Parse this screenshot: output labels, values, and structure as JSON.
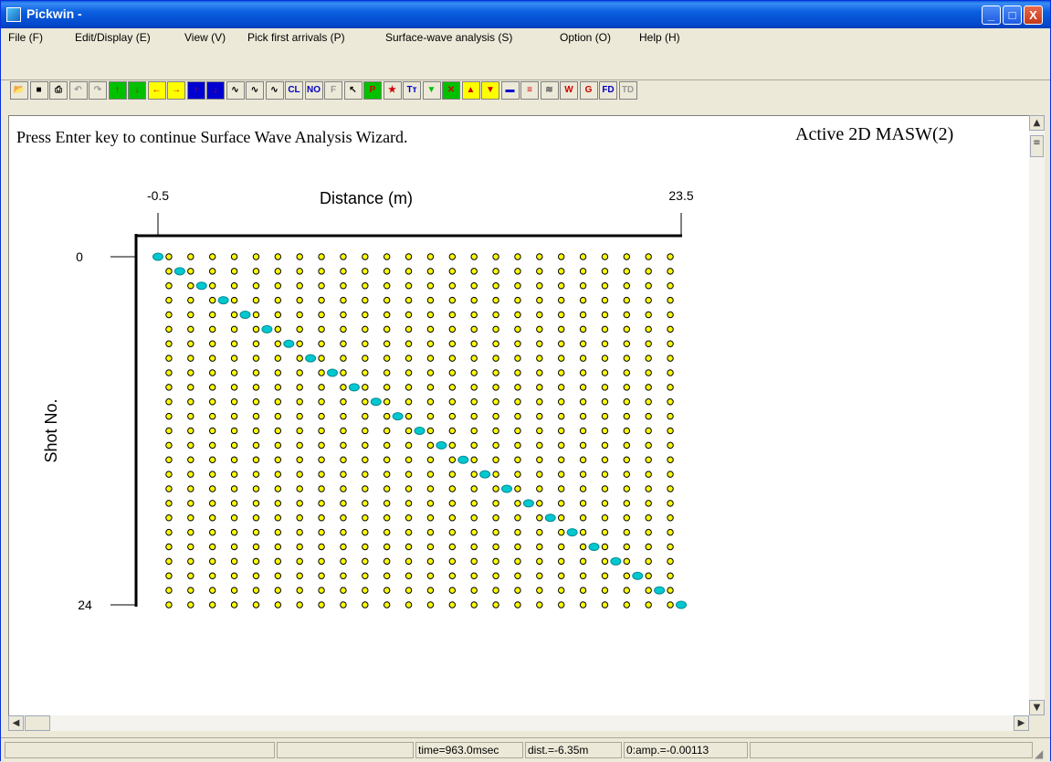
{
  "window": {
    "title": "Pickwin -",
    "buttons": [
      "_",
      "□",
      "X"
    ]
  },
  "menu": [
    "File (F)",
    "Edit/Display (E)",
    "View (V)",
    "Pick first arrivals (P)",
    "Surface-wave analysis (S)",
    "Option (O)",
    "Help (H)"
  ],
  "toolbar": {
    "buttons": [
      {
        "name": "open-icon",
        "glyph": "📂",
        "color": "#8a6d00"
      },
      {
        "name": "save-icon",
        "glyph": "■",
        "color": "#000"
      },
      {
        "name": "print-icon",
        "glyph": "⎙",
        "color": "#000"
      },
      {
        "name": "undo-icon",
        "glyph": "↶",
        "color": "#999"
      },
      {
        "name": "redo-icon",
        "glyph": "↷",
        "color": "#999"
      },
      {
        "name": "up-green-arrow-icon",
        "glyph": "↑",
        "color": "#d00000",
        "bg": "#00c000"
      },
      {
        "name": "down-green-arrow-icon",
        "glyph": "↓",
        "color": "#d00000",
        "bg": "#00c000"
      },
      {
        "name": "left-arrow-icon",
        "glyph": "←",
        "color": "#d00000",
        "bg": "#ffff00"
      },
      {
        "name": "right-arrow-icon",
        "glyph": "→",
        "color": "#d00000",
        "bg": "#ffff00"
      },
      {
        "name": "up-blue-arrow-icon",
        "glyph": "↑",
        "color": "#d00000",
        "bg": "#0000d0"
      },
      {
        "name": "down-blue-arrow-icon",
        "glyph": "↓",
        "color": "#d00000",
        "bg": "#0000d0"
      },
      {
        "name": "waveform-icon",
        "glyph": "∿",
        "color": "#000"
      },
      {
        "name": "waveform-filled-icon",
        "glyph": "∿",
        "color": "#000"
      },
      {
        "name": "waveform-alt-icon",
        "glyph": "∿",
        "color": "#000"
      },
      {
        "name": "clip-icon",
        "glyph": "CL",
        "color": "#0000c0"
      },
      {
        "name": "norm-icon",
        "glyph": "NO",
        "color": "#0000c0"
      },
      {
        "name": "f-icon",
        "glyph": "F",
        "color": "#999"
      },
      {
        "name": "pointer-icon",
        "glyph": "↖",
        "color": "#000"
      },
      {
        "name": "p-pick-icon",
        "glyph": "P",
        "color": "#d00000",
        "bg": "#00c000"
      },
      {
        "name": "star-icon",
        "glyph": "★",
        "color": "#d00000"
      },
      {
        "name": "text-size-icon",
        "glyph": "Tт",
        "color": "#0000c0"
      },
      {
        "name": "green-triangle-down-icon",
        "glyph": "▼",
        "color": "#00c000"
      },
      {
        "name": "cross-icon",
        "glyph": "✕",
        "color": "#d00000",
        "bg": "#00c000"
      },
      {
        "name": "red-triangle-up-icon",
        "glyph": "▲",
        "color": "#d00000",
        "bg": "#ffff00"
      },
      {
        "name": "red-triangle-down-icon",
        "glyph": "▼",
        "color": "#d00000",
        "bg": "#ffff00"
      },
      {
        "name": "color-bar-icon",
        "glyph": "▬",
        "color": "#0000d0"
      },
      {
        "name": "rainbow-icon",
        "glyph": "≡",
        "color": "#d00000"
      },
      {
        "name": "wiggle-icon",
        "glyph": "≋",
        "color": "#555"
      },
      {
        "name": "w-icon",
        "glyph": "W",
        "color": "#d00000"
      },
      {
        "name": "g-icon",
        "glyph": "G",
        "color": "#d00000"
      },
      {
        "name": "fd-icon",
        "glyph": "FD",
        "color": "#0000c0"
      },
      {
        "name": "td-icon",
        "glyph": "TD",
        "color": "#999"
      }
    ]
  },
  "client": {
    "message": "Press Enter key to continue Surface Wave Analysis Wizard.",
    "mode_label": "Active 2D MASW(2)"
  },
  "chart_data": {
    "type": "scatter",
    "xlabel": "Distance (m)",
    "ylabel": "Shot No.",
    "x_ticks": [
      "-0.5",
      "23.5"
    ],
    "y_ticks": [
      "0",
      "24"
    ],
    "xlim": [
      -0.5,
      23.5
    ],
    "ylim": [
      0,
      24
    ],
    "receiver_positions": {
      "x_start": -0.5,
      "x_step": 1,
      "count": 24
    },
    "shots": 24,
    "grid_point_color": "#ffff00",
    "source_color": "#00c8d0",
    "source_positions": [
      -0.5,
      0.5,
      1.5,
      2.5,
      3.5,
      4.5,
      5.5,
      6.5,
      7.5,
      8.5,
      9.5,
      10.5,
      11.5,
      12.5,
      13.5,
      14.5,
      15.5,
      16.5,
      17.5,
      18.5,
      19.5,
      20.5,
      21.5,
      22.5,
      23.5
    ]
  },
  "status": {
    "time": "time=963.0msec",
    "dist": "dist.=-6.35m",
    "amp": "0:amp.=-0.00113"
  }
}
